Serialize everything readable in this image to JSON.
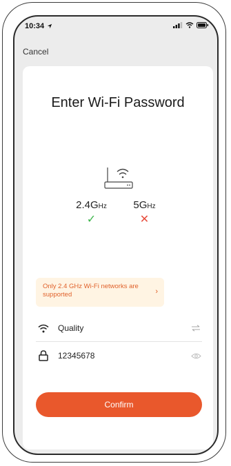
{
  "status_bar": {
    "time": "10:34",
    "icons": [
      "location-arrow-icon",
      "cellular-signal-icon",
      "wifi-icon",
      "battery-icon"
    ]
  },
  "nav": {
    "cancel_label": "Cancel"
  },
  "card": {
    "title": "Enter Wi-Fi Password",
    "bands": [
      {
        "label_main": "2.4G",
        "label_unit": "Hz",
        "supported": true,
        "mark": "✓"
      },
      {
        "label_main": "5G",
        "label_unit": "Hz",
        "supported": false,
        "mark": "✕"
      }
    ],
    "warning": {
      "text": "Only 2.4 GHz Wi-Fi networks are supported",
      "chevron": "›"
    },
    "wifi_field": {
      "value": "Quality",
      "icon": "wifi-icon",
      "action_icon": "switch-arrows-icon"
    },
    "password_field": {
      "value": "12345678",
      "icon": "lock-icon",
      "action_icon": "eye-icon"
    },
    "confirm_label": "Confirm"
  },
  "colors": {
    "accent": "#e9582c",
    "check": "#3bb54a",
    "cross": "#e74c3c",
    "warning_bg": "#fff4e3",
    "warning_text": "#e0612b"
  }
}
